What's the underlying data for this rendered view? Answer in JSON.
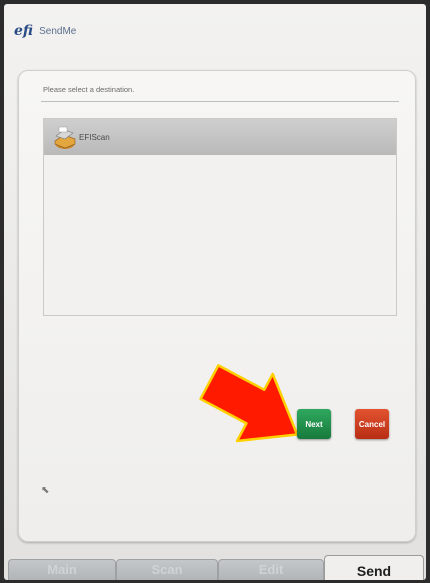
{
  "header": {
    "logo": "efi",
    "app_title": "SendMe"
  },
  "panel": {
    "prompt": "Please select a destination.",
    "destinations": [
      {
        "label": "EFIScan",
        "icon": "scanner-icon",
        "selected": true
      }
    ]
  },
  "buttons": {
    "next": "Next",
    "cancel": "Cancel"
  },
  "tabs": [
    {
      "label": "Main",
      "active": false
    },
    {
      "label": "Scan",
      "active": false
    },
    {
      "label": "Edit",
      "active": false
    },
    {
      "label": "Send",
      "active": true
    }
  ],
  "colors": {
    "next": "#1f8b49",
    "cancel": "#cc3a1f",
    "arrow": "#ff1a00",
    "arrow_outline": "#ffd000"
  }
}
